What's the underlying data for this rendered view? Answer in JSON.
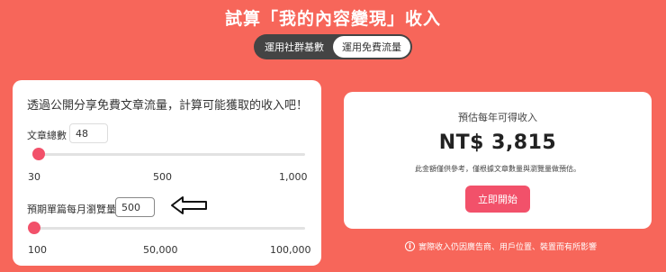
{
  "title": "試算「我的內容變現」收入",
  "toggle": {
    "options": [
      "運用社群基數",
      "運用免費流量"
    ],
    "active_index": 1
  },
  "calculator": {
    "intro": "透過公開分享免費文章流量，計算可能獲取的收入吧！",
    "articles": {
      "label": "文章總數",
      "value": "48",
      "slider_min": 30,
      "slider_max": 1000,
      "slider_value": 48,
      "ticks": [
        "30",
        "500",
        "1,000"
      ]
    },
    "views": {
      "label": "預期單篇每月瀏覽量",
      "value": "500",
      "slider_min": 100,
      "slider_max": 100000,
      "slider_value": 500,
      "ticks": [
        "100",
        "50,000",
        "100,000"
      ]
    }
  },
  "estimate": {
    "label": "預估每年可得收入",
    "value": "NT$ 3,815",
    "note": "此金額僅供參考，僅根據文章數量與瀏覽量做預估。",
    "button": "立即開始"
  },
  "footnote": "實際收入仍因廣告商、用戶位置、裝置而有所影響",
  "colors": {
    "background": "#f7665a",
    "accent": "#f2516a",
    "toggle_bg": "#444444"
  },
  "icons": [
    "info-icon",
    "arrow-left-icon"
  ]
}
